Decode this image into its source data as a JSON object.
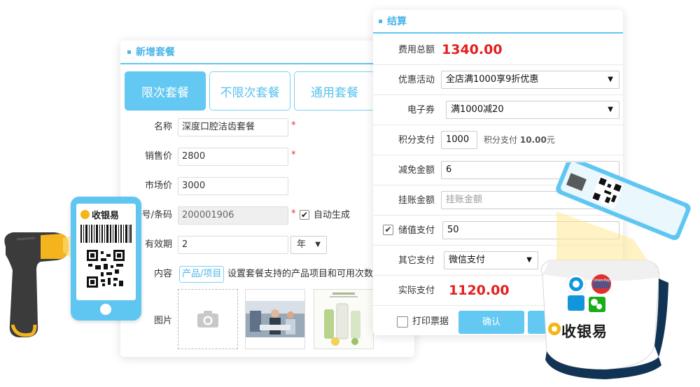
{
  "left_panel": {
    "title": "新增套餐",
    "tabs": [
      "限次套餐",
      "不限次套餐",
      "通用套餐"
    ],
    "name_label": "名称",
    "name_value": "深度口腔洁齿套餐",
    "price_label": "销售价",
    "price_value": "2800",
    "market_label": "市场价",
    "market_value": "3000",
    "code_label": "号/条码",
    "code_value": "200001906",
    "auto_label": "自动生成",
    "validity_label": "有效期",
    "validity_value": "2",
    "validity_unit": "年",
    "content_label": "内容",
    "content_button": "产品/项目",
    "content_hint": "设置套餐支持的产品项目和可用次数",
    "image_label": "图片",
    "required_mark": "*"
  },
  "right_panel": {
    "title": "结算",
    "total_label": "费用总额",
    "total_value": "1340.00",
    "promo_label": "优惠活动",
    "promo_value": "全店满1000享9折优惠",
    "coupon_label": "电子券",
    "coupon_value": "满1000减20",
    "points_label": "积分支付",
    "points_value": "1000",
    "points_note_prefix": "积分支付",
    "points_note_amount": "10.00",
    "points_note_suffix": "元",
    "discount_label": "减免金额",
    "discount_value": "6",
    "credit_label": "挂账金额",
    "credit_placeholder": "挂账金额",
    "stored_label": "储值支付",
    "stored_value": "50",
    "other_label": "其它支付",
    "other_value": "微信支付",
    "actual_label": "实际支付",
    "actual_value": "1120.00",
    "print_label": "打印票据",
    "confirm_label": "确认"
  },
  "phone": {
    "brand": "收银易"
  },
  "box": {
    "brand": "收银易",
    "unionpay_text": "UnionPay",
    "alipay_char": "支"
  },
  "icons": [
    "camera-icon",
    "checkbox-checked-icon",
    "dropdown-arrow-icon"
  ],
  "colors": {
    "accent": "#63c8f2",
    "accent_text": "#4bb6e8",
    "amount_red": "#e51e1e",
    "required_red": "#e03030"
  }
}
